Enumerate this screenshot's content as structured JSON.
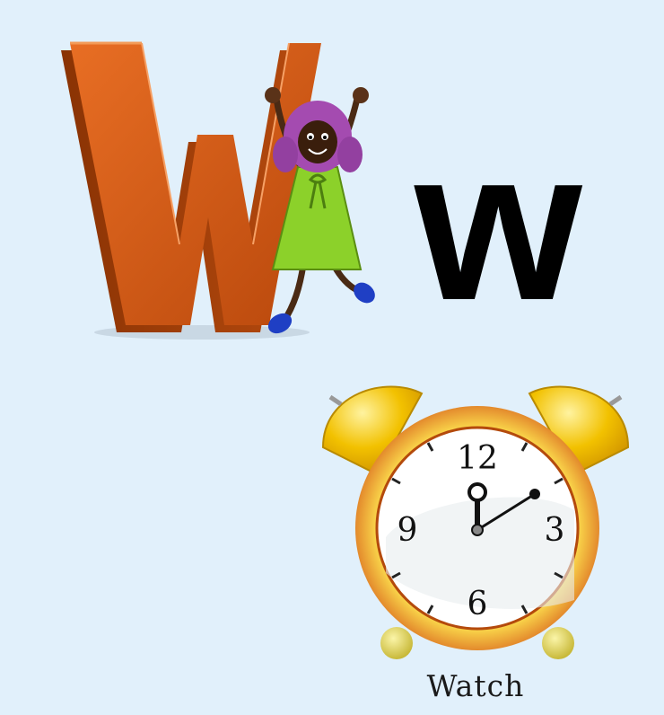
{
  "letter": {
    "decorative": "W",
    "lowercase": "w"
  },
  "clock": {
    "numerals": {
      "twelve": "12",
      "three": "3",
      "six": "6",
      "nine": "9"
    },
    "time": "12:12"
  },
  "word": "Watch",
  "colors": {
    "background": "#e1f0fb",
    "letter_3d": "#d05a14",
    "dress": "#8cd12a",
    "hair": "#a44bb0",
    "clock_ring": "#e0a020",
    "bells": "#f2c100"
  }
}
